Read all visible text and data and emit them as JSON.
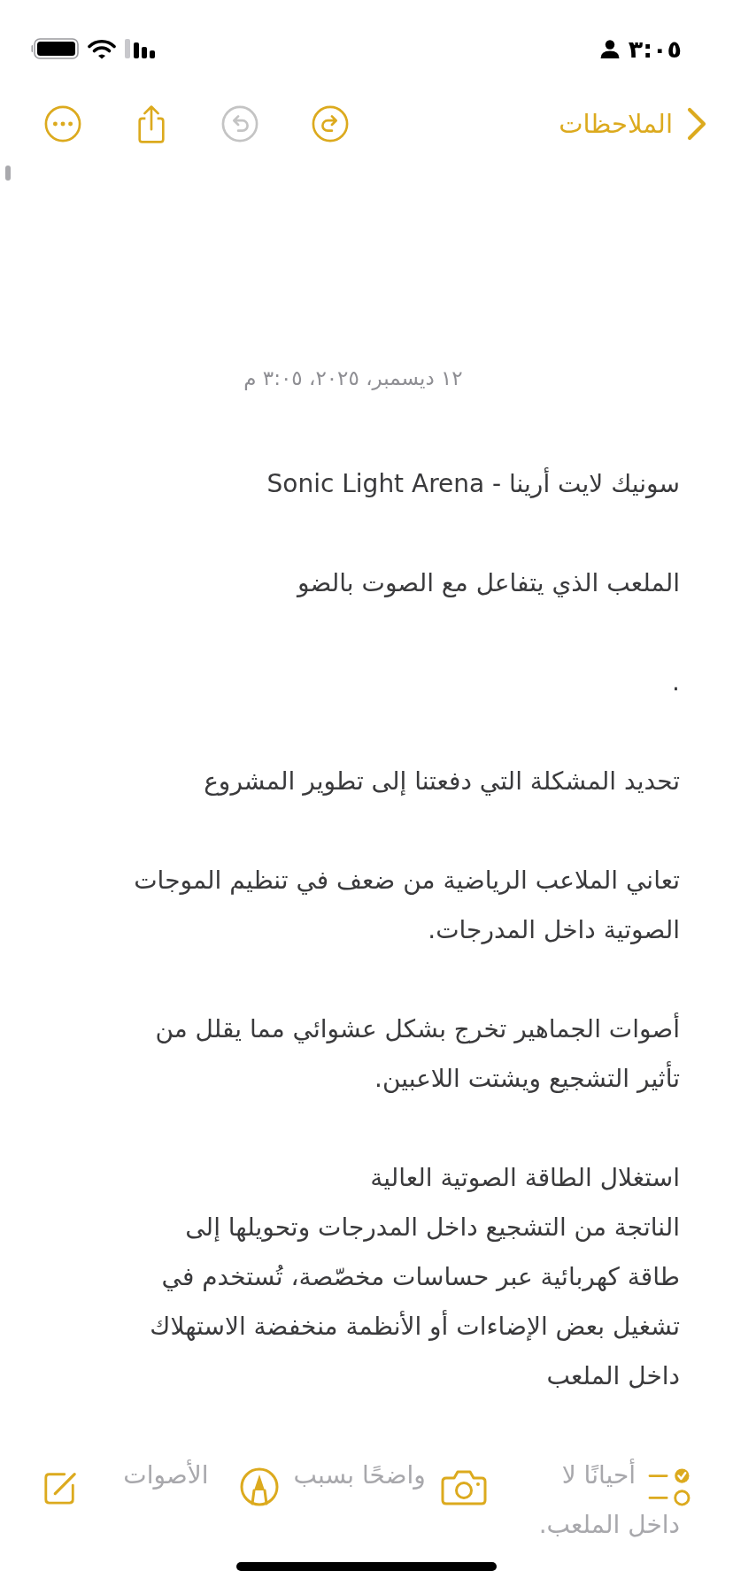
{
  "status_bar": {
    "time": "٣:٠٥"
  },
  "nav": {
    "back_label": "الملاحظات",
    "actions": [
      {
        "kind": "undo",
        "disabled": false
      },
      {
        "kind": "redo",
        "disabled": true
      },
      {
        "kind": "share",
        "disabled": false
      },
      {
        "kind": "more",
        "disabled": false
      }
    ]
  },
  "note": {
    "date": "١٢ ديسمبر، ٢٠٢٥، ٣:٠٥ م",
    "paragraphs": [
      {
        "lines": [
          "سونيك لايت أرينا - Sonic Light Arena"
        ]
      },
      {
        "lines": [
          "الملعب الذي يتفاعل مع الصوت بالضو"
        ]
      },
      {
        "lines": [
          "."
        ]
      },
      {
        "lines": [
          "تحديد المشكلة التي دفعتنا إلى تطوير المشروع"
        ]
      },
      {
        "lines": [
          "تعاني الملاعب الرياضية من ضعف في تنظيم الموجات",
          "الصوتية داخل المدرجات."
        ]
      },
      {
        "lines": [
          "أصوات الجماهير تخرج بشكل عشوائي مما يقلل من",
          "تأثير التشجيع ويشتت اللاعبين."
        ]
      },
      {
        "lines": [
          "استغلال الطاقة الصوتية العالية",
          "الناتجة من التشجيع داخل المدرجات وتحويلها إلى",
          "طاقة كهربائية عبر حساسات مخصّصة، تُستخدم في",
          "تشغيل بعض الإضاءات أو الأنظمة منخفضة الاستهلاك",
          "داخل الملعب"
        ]
      }
    ],
    "faded_lines": [
      {
        "fragments": [
          "أحيانًا لا",
          "واضحًا بسبب",
          "الأصوات"
        ]
      },
      {
        "fragments": [
          "داخل الملعب."
        ]
      }
    ]
  },
  "toolbar": {
    "items": [
      {
        "kind": "checklist"
      },
      {
        "kind": "camera"
      },
      {
        "kind": "markup"
      },
      {
        "kind": "compose"
      }
    ]
  }
}
